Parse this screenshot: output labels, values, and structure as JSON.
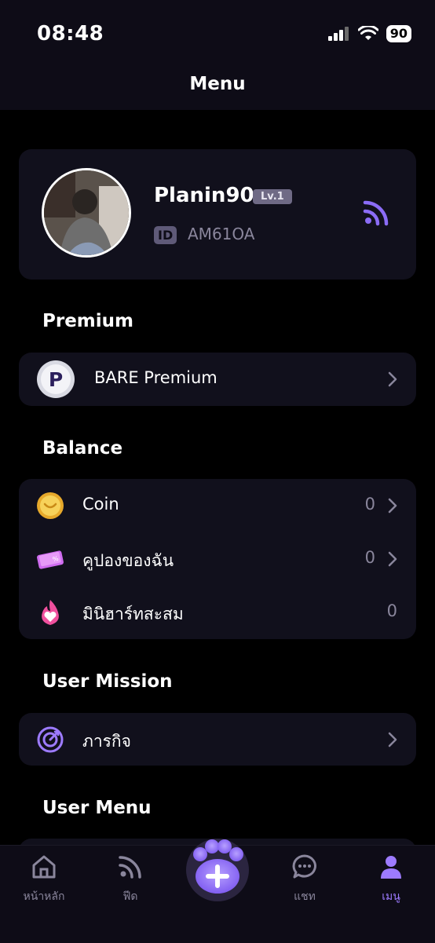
{
  "status_bar": {
    "time": "08:48",
    "battery": "90"
  },
  "header": {
    "title": "Menu"
  },
  "profile": {
    "username": "Planin90",
    "level": "Lv.1",
    "id_label": "ID",
    "id_value": "AM61OA"
  },
  "premium": {
    "section_title": "Premium",
    "item": {
      "icon": "premium-p-icon",
      "label": "BARE Premium"
    }
  },
  "balance": {
    "section_title": "Balance",
    "items": [
      {
        "icon": "coin-icon",
        "label": "Coin",
        "value": "0"
      },
      {
        "icon": "coupon-icon",
        "label": "คูปองของฉัน",
        "value": "0"
      },
      {
        "icon": "mini-heart-icon",
        "label": "มินิฮาร์ทสะสม",
        "value": "0"
      }
    ]
  },
  "user_mission": {
    "section_title": "User Mission",
    "item": {
      "icon": "mission-target-icon",
      "label": "ภารกิจ"
    }
  },
  "user_menu": {
    "section_title": "User Menu"
  },
  "tabbar": {
    "items": [
      {
        "icon": "home-icon",
        "label": "หน้าหลัก"
      },
      {
        "icon": "feed-icon",
        "label": "ฟีด"
      },
      {
        "icon": "add-paw-icon",
        "label": ""
      },
      {
        "icon": "chat-icon",
        "label": "แชท"
      },
      {
        "icon": "user-icon",
        "label": "เมนู"
      }
    ],
    "active_index": 4
  },
  "colors": {
    "accent": "#9d7bff",
    "background": "#000000",
    "card": "#11101c",
    "muted_text": "#8a869c"
  }
}
